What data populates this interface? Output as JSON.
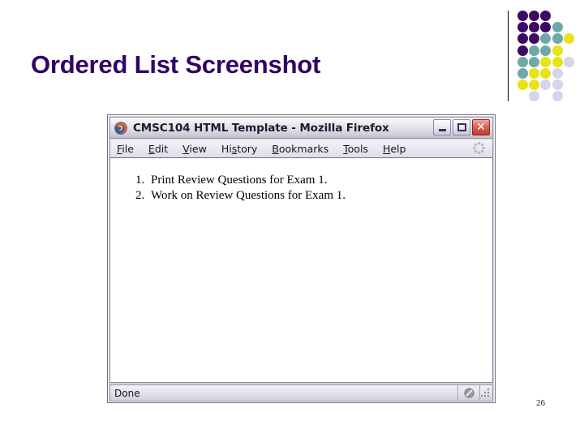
{
  "slide": {
    "title": "Ordered List Screenshot",
    "title_color": "#330066",
    "page_number": "26"
  },
  "decoration": {
    "divider_line_color": "#000000",
    "palette": {
      "purple": "#3B0B63",
      "teal": "#6FA8A8",
      "yellow": "#E8E316",
      "lavender": "#D5D4E8"
    },
    "dot_grid": [
      [
        "purple",
        "purple",
        "purple",
        null,
        null
      ],
      [
        "purple",
        "purple",
        "purple",
        "teal",
        null
      ],
      [
        "purple",
        "purple",
        "teal",
        "teal",
        "yellow"
      ],
      [
        "purple",
        "teal",
        "teal",
        "yellow",
        null
      ],
      [
        "teal",
        "teal",
        "yellow",
        "yellow",
        "lavender"
      ],
      [
        "teal",
        "yellow",
        "yellow",
        "lavender",
        null
      ],
      [
        "yellow",
        "yellow",
        "lavender",
        "lavender",
        null
      ],
      [
        null,
        "lavender",
        null,
        "lavender",
        null
      ]
    ]
  },
  "browser": {
    "title": "CMSC104 HTML Template - Mozilla Firefox",
    "app_icon": "firefox-logo-icon",
    "window_buttons": [
      {
        "name": "minimize",
        "label": "_"
      },
      {
        "name": "maximize",
        "label": "□"
      },
      {
        "name": "close",
        "label": "✕"
      }
    ],
    "menu": [
      {
        "label": "File",
        "accel": "F",
        "pre": "",
        "post": "ile"
      },
      {
        "label": "Edit",
        "accel": "E",
        "pre": "",
        "post": "dit"
      },
      {
        "label": "View",
        "accel": "V",
        "pre": "",
        "post": "iew"
      },
      {
        "label": "History",
        "accel": "s",
        "pre": "Hi",
        "post": "tory"
      },
      {
        "label": "Bookmarks",
        "accel": "B",
        "pre": "",
        "post": "ookmarks"
      },
      {
        "label": "Tools",
        "accel": "T",
        "pre": "",
        "post": "ools"
      },
      {
        "label": "Help",
        "accel": "H",
        "pre": "",
        "post": "elp"
      }
    ],
    "throbber_icon": "loading-throbber-icon",
    "page_content": {
      "list_type": "ordered",
      "items": [
        "Print Review Questions for Exam 1.",
        "Work on Review Questions for Exam 1."
      ]
    },
    "status": {
      "text": "Done",
      "security_icon": "no-encryption-icon",
      "resize_grip_icon": "resize-grip-icon"
    }
  }
}
